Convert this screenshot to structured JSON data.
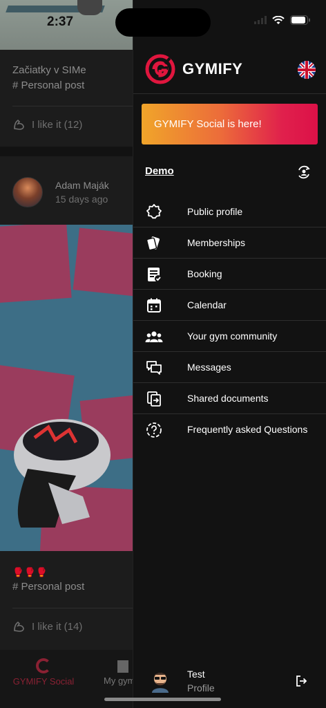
{
  "status_bar": {
    "time": "2:37"
  },
  "feed": {
    "post1": {
      "title": "Začiatky v SIMe",
      "tag": "# Personal post",
      "like_label": "I like it (12)"
    },
    "post2": {
      "author": "Adam Maják",
      "date": "15 days ago",
      "emojis": "🥊🥊🥊",
      "tag": "# Personal post",
      "like_label": "I like it (14)"
    },
    "tabs": [
      {
        "label": "GYMIFY Social",
        "icon": "gymify-g-icon"
      },
      {
        "label": "My gym",
        "icon": "building-icon"
      }
    ]
  },
  "drawer": {
    "brand": "GYMIFY",
    "language_icon": "uk-flag-icon",
    "promo": "GYMIFY Social is here!",
    "gym_name": "Demo",
    "menu": [
      {
        "label": "Public profile",
        "icon": "badge-icon"
      },
      {
        "label": "Memberships",
        "icon": "cards-icon"
      },
      {
        "label": "Booking",
        "icon": "booking-icon"
      },
      {
        "label": "Calendar",
        "icon": "calendar-icon"
      },
      {
        "label": "Your gym community",
        "icon": "community-icon"
      },
      {
        "label": "Messages",
        "icon": "messages-icon"
      },
      {
        "label": "Shared documents",
        "icon": "documents-icon"
      },
      {
        "label": "Frequently asked Questions",
        "icon": "faq-icon"
      }
    ],
    "user": {
      "name": "Test",
      "subtitle": "Profile"
    }
  },
  "colors": {
    "brand_red": "#e0163e",
    "promo_gradient_start": "#f0a52a",
    "promo_gradient_end": "#dc1148",
    "drawer_bg": "#121212"
  }
}
